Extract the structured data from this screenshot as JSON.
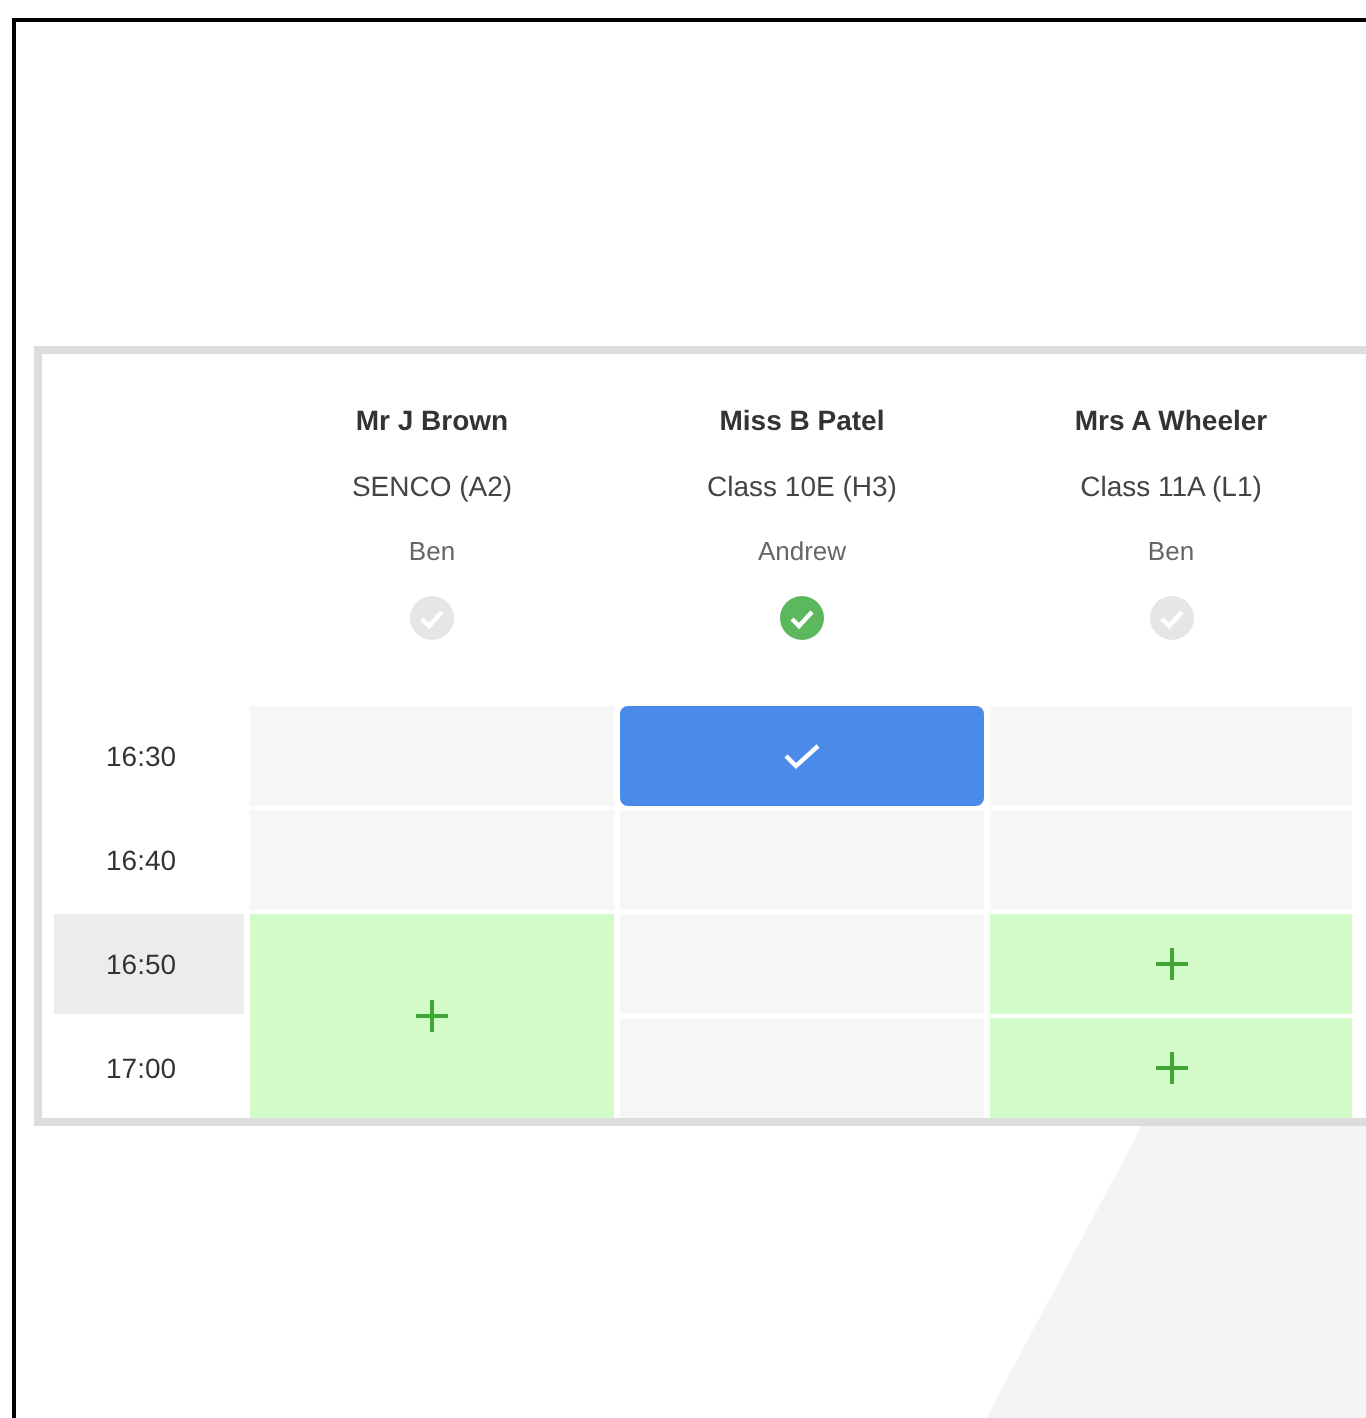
{
  "teachers": [
    {
      "name": "Mr J Brown",
      "subject": "SENCO (A2)",
      "student": "Ben",
      "confirmed": false
    },
    {
      "name": "Miss B Patel",
      "subject": "Class 10E (H3)",
      "student": "Andrew",
      "confirmed": true
    },
    {
      "name": "Mrs A Wheeler",
      "subject": "Class 11A (L1)",
      "student": "Ben",
      "confirmed": false
    }
  ],
  "times": [
    {
      "label": "16:30",
      "highlighted": false
    },
    {
      "label": "16:40",
      "highlighted": false
    },
    {
      "label": "16:50",
      "highlighted": true
    },
    {
      "label": "17:00",
      "highlighted": false
    }
  ],
  "slots": [
    [
      {
        "kind": "empty"
      },
      {
        "kind": "empty"
      },
      {
        "kind": "available_double"
      }
    ],
    [
      {
        "kind": "booked"
      },
      {
        "kind": "empty"
      },
      {
        "kind": "empty"
      },
      {
        "kind": "empty"
      }
    ],
    [
      {
        "kind": "empty"
      },
      {
        "kind": "empty"
      },
      {
        "kind": "available"
      },
      {
        "kind": "available"
      }
    ]
  ]
}
